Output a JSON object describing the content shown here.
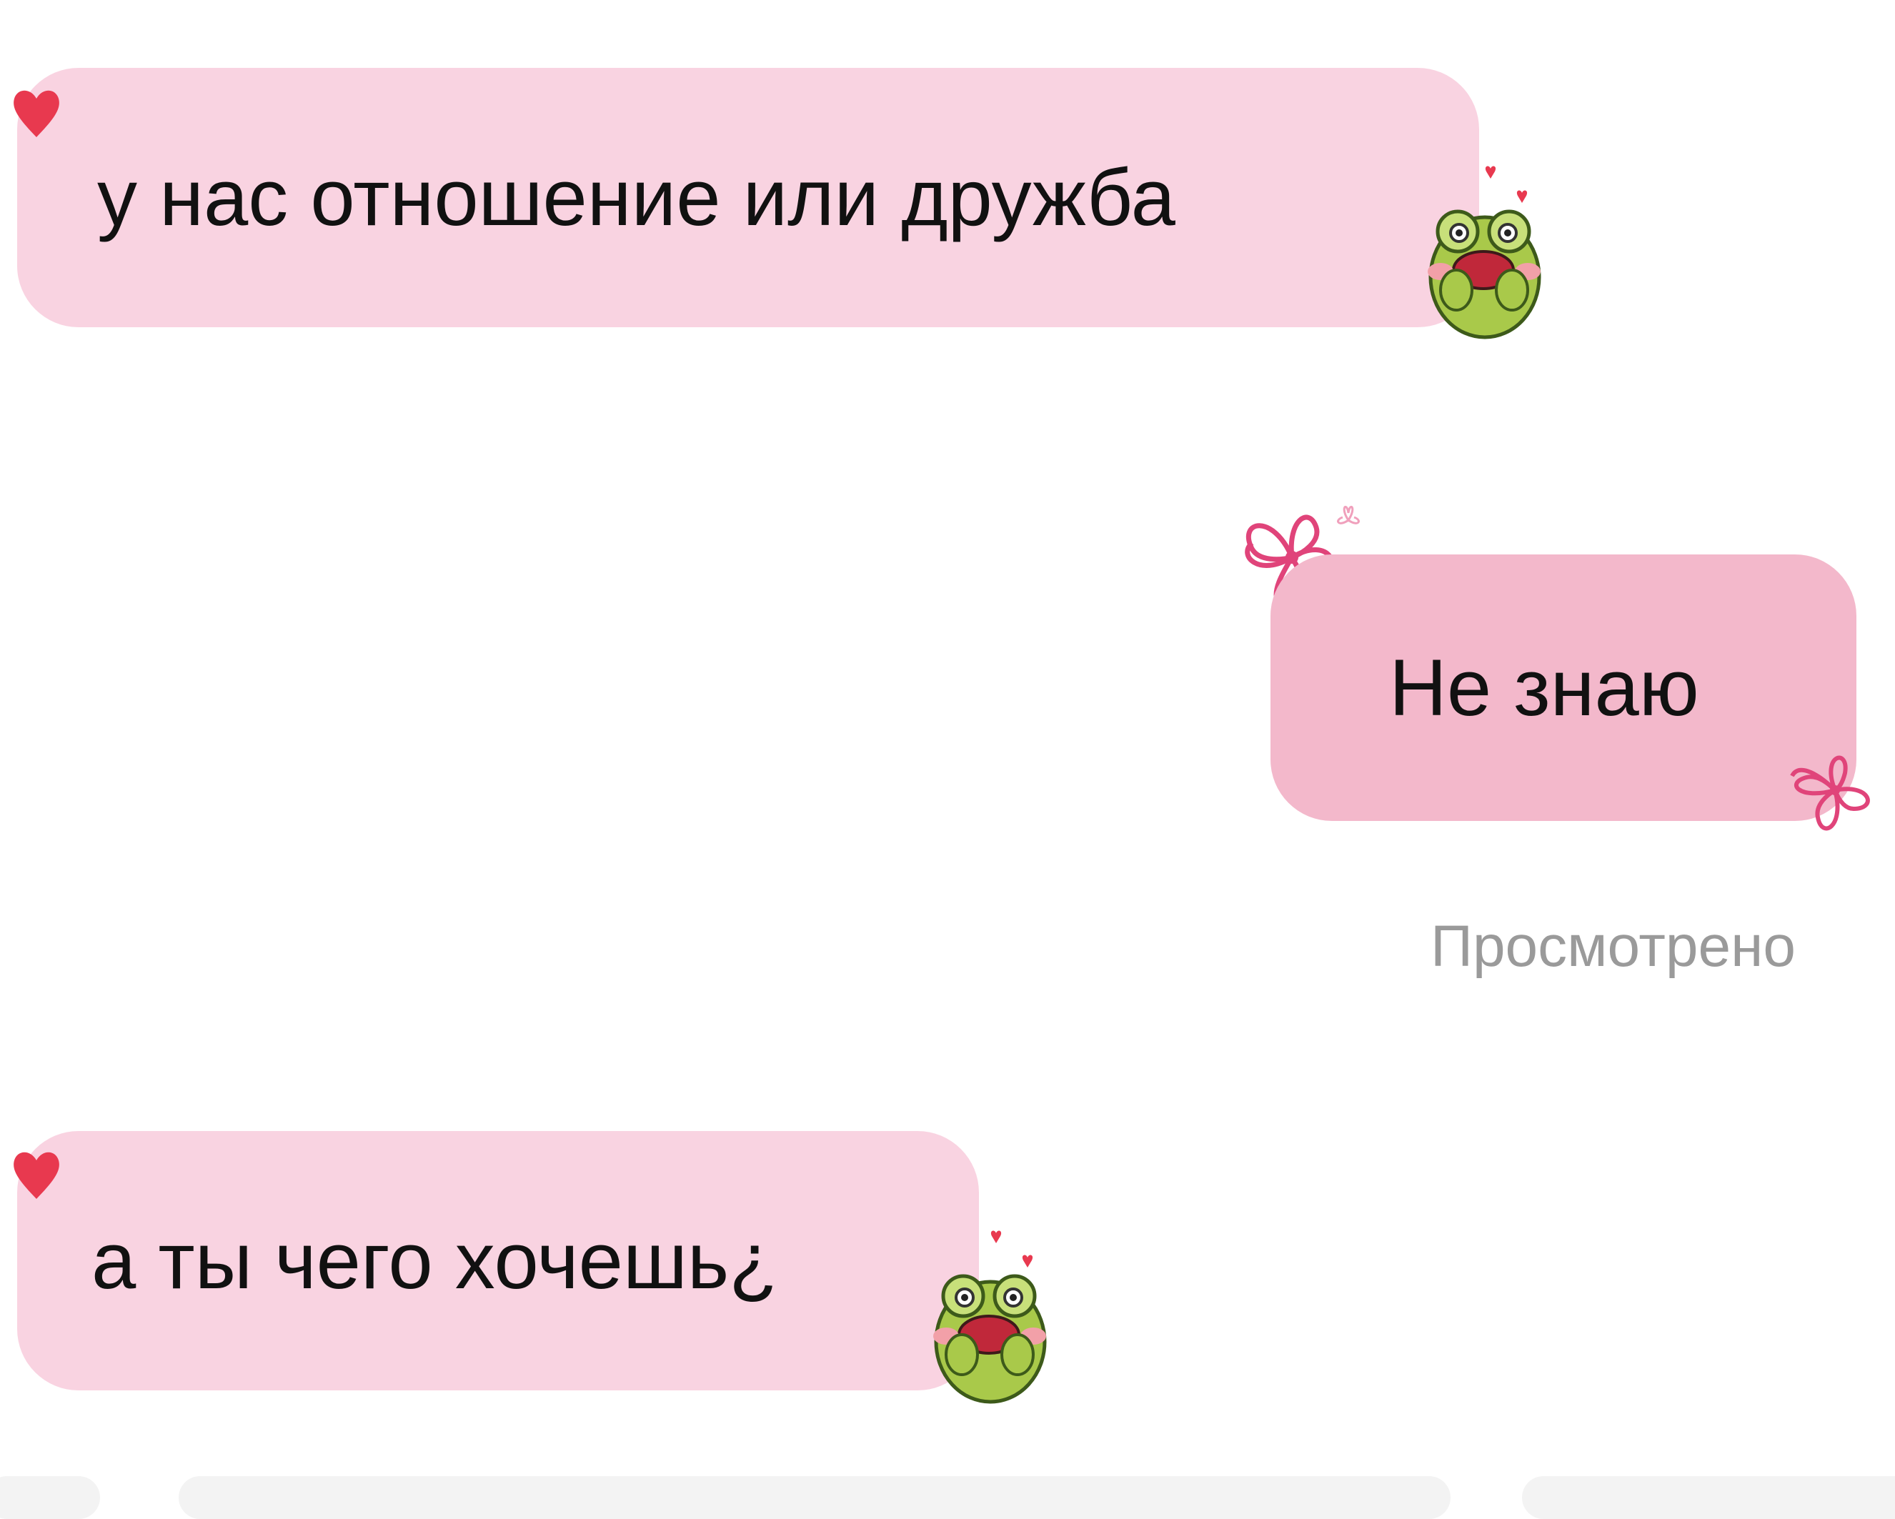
{
  "messages": [
    {
      "id": "msg1",
      "direction": "incoming",
      "text": "у нас отношение или дружба"
    },
    {
      "id": "msg2",
      "direction": "outgoing",
      "text": "Не знаю"
    },
    {
      "id": "msg3",
      "direction": "incoming",
      "text": "а ты чего хочешь¿"
    }
  ],
  "status": {
    "seen": "Просмотрено"
  },
  "colors": {
    "incoming_bubble": "#f9d3e1",
    "outgoing_bubble": "#f3b8cb",
    "seen_text": "#9a9a9a",
    "heart": "#e8394f",
    "flower": "#e0447a",
    "frog": "#a9c94a"
  },
  "icons": [
    "heart-icon",
    "frog-sticker-icon",
    "flower-icon"
  ]
}
